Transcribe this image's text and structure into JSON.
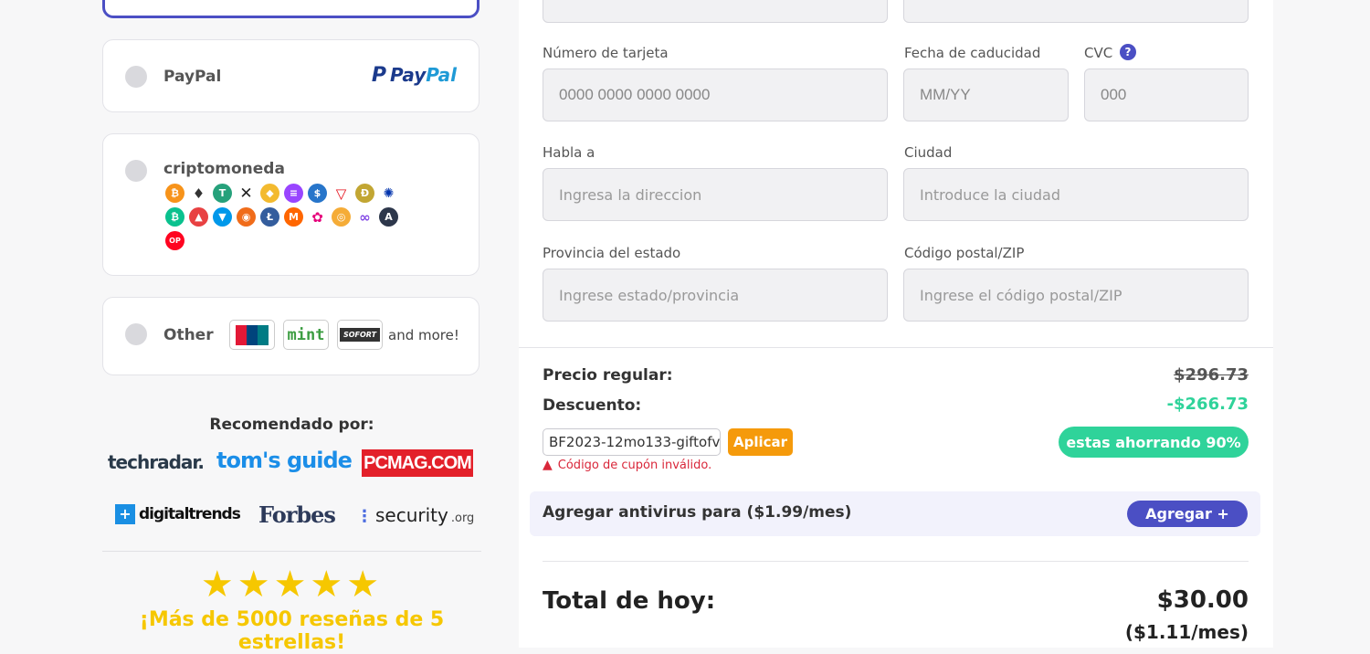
{
  "methods": {
    "paypal_label": "PayPal",
    "paypal_logo_pay": "Pay",
    "paypal_logo_pal": "Pal",
    "crypto_label": "criptomoneda",
    "crypto_coins_row1": [
      "bitcoin-icon",
      "ethereum-icon",
      "tether-icon",
      "xrp-icon",
      "bnb-icon",
      "solana-icon",
      "usdc-icon",
      "tron-icon",
      "dogecoin-icon",
      "cardano-icon"
    ],
    "crypto_coins_row2": [
      "bitcoin-cash-icon",
      "avalanche-icon",
      "toncoin-icon",
      "shiba-inu-icon",
      "litecoin-icon",
      "monero-icon",
      "polkadot-icon",
      "dai-icon",
      "polygon-icon",
      "arbitrum-icon"
    ],
    "crypto_coins_row3": [
      "optimism-icon"
    ],
    "optimism_badge": "OP",
    "other_label": "Other",
    "other_badges": [
      "UnionPay",
      "mint",
      "SOFORT"
    ],
    "other_more": "and more!"
  },
  "recommended": {
    "title": "Recomendado por:",
    "brands": [
      "techradar.",
      "tom's guide",
      "PCMAG.COM",
      "digitaltrends",
      "Forbes",
      "security"
    ],
    "security_suffix": ".org",
    "stars": "★★★★★",
    "reviews": "¡Más de 5000 reseñas de 5 estrellas!"
  },
  "form": {
    "card_number_label": "Número de tarjeta",
    "card_number_placeholder": "0000 0000 0000 0000",
    "expiry_label": "Fecha de caducidad",
    "expiry_placeholder": "MM/YY",
    "cvc_label": "CVC",
    "address_label": "Habla a",
    "address_placeholder": "Ingresa la direccion",
    "city_label": "Ciudad",
    "city_placeholder": "Introduce la ciudad",
    "state_label": "Provincia del estado",
    "state_placeholder": "Ingrese estado/provincia",
    "zip_label": "Código postal/ZIP",
    "zip_placeholder": "Ingrese el código postal/ZIP"
  },
  "summary": {
    "regular_label": "Precio regular:",
    "regular_value": "$296.73",
    "discount_label": "Descuento:",
    "discount_value": "-$266.73",
    "coupon_code": "BF2023-12mo133-giftofv",
    "apply_label": "Aplicar",
    "saving": "estas ahorrando 90%",
    "coupon_error": "Código de cupón inválido.",
    "antivirus_text": "Agregar antivirus para ($1.99/mes)",
    "antivirus_button": "Agregar +",
    "total_label": "Total de hoy:",
    "total_value": "$30.00",
    "total_month": "($1.11/mes)"
  },
  "colors": {
    "accent": "#4b4fc4",
    "orange": "#f59a0b",
    "green": "#2fd39a",
    "star": "#f6c700",
    "error": "#d9273a"
  }
}
